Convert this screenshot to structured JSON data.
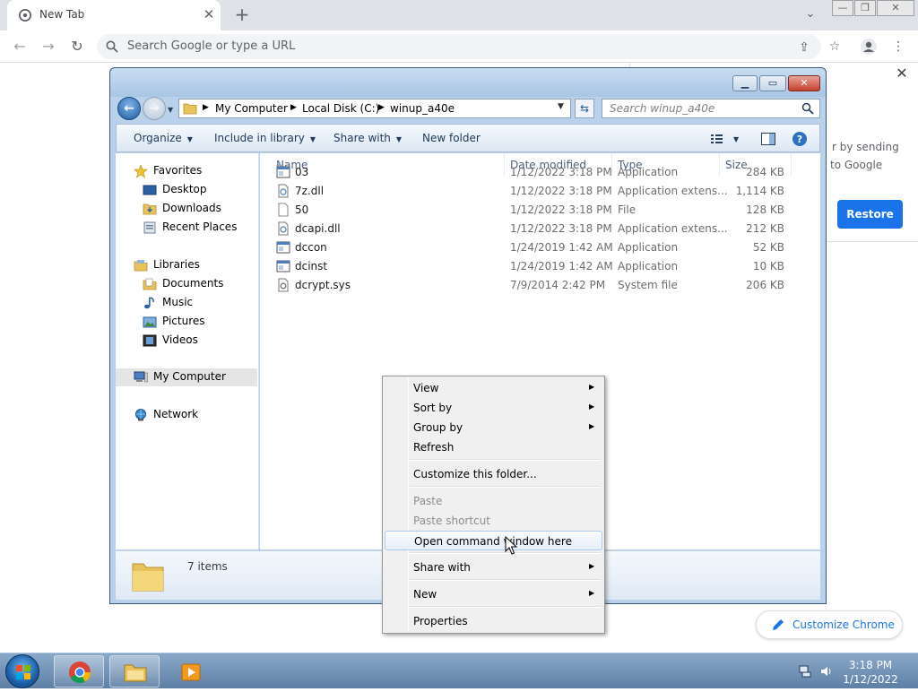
{
  "browser": {
    "tab_title": "New Tab",
    "omnibox_placeholder": "Search Google or type a URL",
    "side_panel": {
      "text_line1": "r by sending",
      "text_line2": "to Google",
      "restore_label": "Restore"
    },
    "customize_label": "Customize Chrome",
    "accent_color": "#1a73e8"
  },
  "explorer": {
    "breadcrumb": [
      "My Computer",
      "Local Disk (C:)",
      "winup_a40e"
    ],
    "search_placeholder": "Search winup_a40e",
    "commands": {
      "organize": "Organize",
      "include_in_library": "Include in library",
      "share_with": "Share with",
      "new_folder": "New folder"
    },
    "nav": {
      "favorites": "Favorites",
      "desktop": "Desktop",
      "downloads": "Downloads",
      "recent_places": "Recent Places",
      "libraries": "Libraries",
      "documents": "Documents",
      "music": "Music",
      "pictures": "Pictures",
      "videos": "Videos",
      "my_computer": "My Computer",
      "network": "Network"
    },
    "columns": {
      "name": "Name",
      "date_modified": "Date modified",
      "type": "Type",
      "size": "Size"
    },
    "files": [
      {
        "name": "03",
        "date": "1/12/2022 3:18 PM",
        "type": "Application",
        "size": "284 KB",
        "icon": "application-icon"
      },
      {
        "name": "7z.dll",
        "date": "1/12/2022 3:18 PM",
        "type": "Application extens...",
        "size": "1,114 KB",
        "icon": "dll-icon"
      },
      {
        "name": "50",
        "date": "1/12/2022 3:18 PM",
        "type": "File",
        "size": "128 KB",
        "icon": "file-icon"
      },
      {
        "name": "dcapi.dll",
        "date": "1/12/2022 3:18 PM",
        "type": "Application extens...",
        "size": "212 KB",
        "icon": "dll-icon"
      },
      {
        "name": "dccon",
        "date": "1/24/2019 1:42 AM",
        "type": "Application",
        "size": "52 KB",
        "icon": "application-icon"
      },
      {
        "name": "dcinst",
        "date": "1/24/2019 1:42 AM",
        "type": "Application",
        "size": "10 KB",
        "icon": "application-icon"
      },
      {
        "name": "dcrypt.sys",
        "date": "7/9/2014 2:42 PM",
        "type": "System file",
        "size": "206 KB",
        "icon": "system-file-icon"
      }
    ],
    "item_count": "7 items"
  },
  "context_menu": {
    "items": [
      {
        "label": "View",
        "submenu": true,
        "disabled": false
      },
      {
        "label": "Sort by",
        "submenu": true,
        "disabled": false
      },
      {
        "label": "Group by",
        "submenu": true,
        "disabled": false
      },
      {
        "label": "Refresh",
        "submenu": false,
        "disabled": false
      },
      {
        "label": "Customize this folder...",
        "submenu": false,
        "disabled": false
      },
      {
        "label": "Paste",
        "submenu": false,
        "disabled": true
      },
      {
        "label": "Paste shortcut",
        "submenu": false,
        "disabled": true
      },
      {
        "label": "Open command window here",
        "submenu": false,
        "disabled": false,
        "highlighted": true
      },
      {
        "label": "Share with",
        "submenu": true,
        "disabled": false
      },
      {
        "label": "New",
        "submenu": true,
        "disabled": false
      },
      {
        "label": "Properties",
        "submenu": false,
        "disabled": false
      }
    ]
  },
  "taskbar": {
    "time": "3:18 PM",
    "date": "1/12/2022"
  }
}
